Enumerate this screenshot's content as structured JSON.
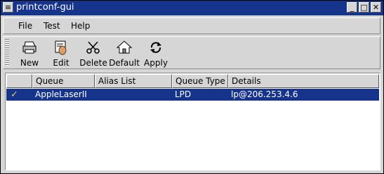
{
  "window": {
    "title": "printconf-gui"
  },
  "menu": {
    "items": [
      {
        "label": "File"
      },
      {
        "label": "Test"
      },
      {
        "label": "Help"
      }
    ]
  },
  "toolbar": {
    "buttons": [
      {
        "label": "New",
        "icon": "printer-icon"
      },
      {
        "label": "Edit",
        "icon": "edit-icon"
      },
      {
        "label": "Delete",
        "icon": "scissors-icon"
      },
      {
        "label": "Default",
        "icon": "home-icon"
      },
      {
        "label": "Apply",
        "icon": "refresh-icon"
      }
    ]
  },
  "table": {
    "columns": [
      "",
      "Queue",
      "Alias List",
      "Queue Type",
      "Details"
    ],
    "rows": [
      {
        "default": "✓",
        "queue": "AppleLaserII",
        "alias": "",
        "type": "LPD",
        "details": "lp@206.253.4.6"
      }
    ]
  },
  "colors": {
    "titlebar": "#16348c",
    "selection": "#16348c",
    "check": "#e0d040"
  }
}
